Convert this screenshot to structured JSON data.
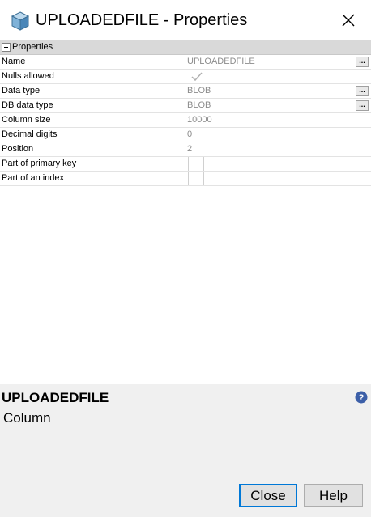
{
  "window": {
    "title": "UPLOADEDFILE - Properties"
  },
  "grid": {
    "section_label": "Properties",
    "rows": [
      {
        "name": "Name",
        "value": "UPLOADEDFILE",
        "has_button": true
      },
      {
        "name": "Nulls allowed",
        "value": "",
        "checked": true
      },
      {
        "name": "Data type",
        "value": "BLOB",
        "has_button": true
      },
      {
        "name": "DB data type",
        "value": "BLOB",
        "has_button": true
      },
      {
        "name": "Column size",
        "value": "10000"
      },
      {
        "name": "Decimal digits",
        "value": "0"
      },
      {
        "name": "Position",
        "value": "2"
      },
      {
        "name": "Part of primary key",
        "value": "",
        "checked": false
      },
      {
        "name": "Part of an index",
        "value": "",
        "checked": false
      }
    ],
    "ellipsis_label": "..."
  },
  "description": {
    "title": "UPLOADEDFILE",
    "subtitle": "Column"
  },
  "buttons": {
    "close_label": "Close",
    "help_label": "Help"
  }
}
